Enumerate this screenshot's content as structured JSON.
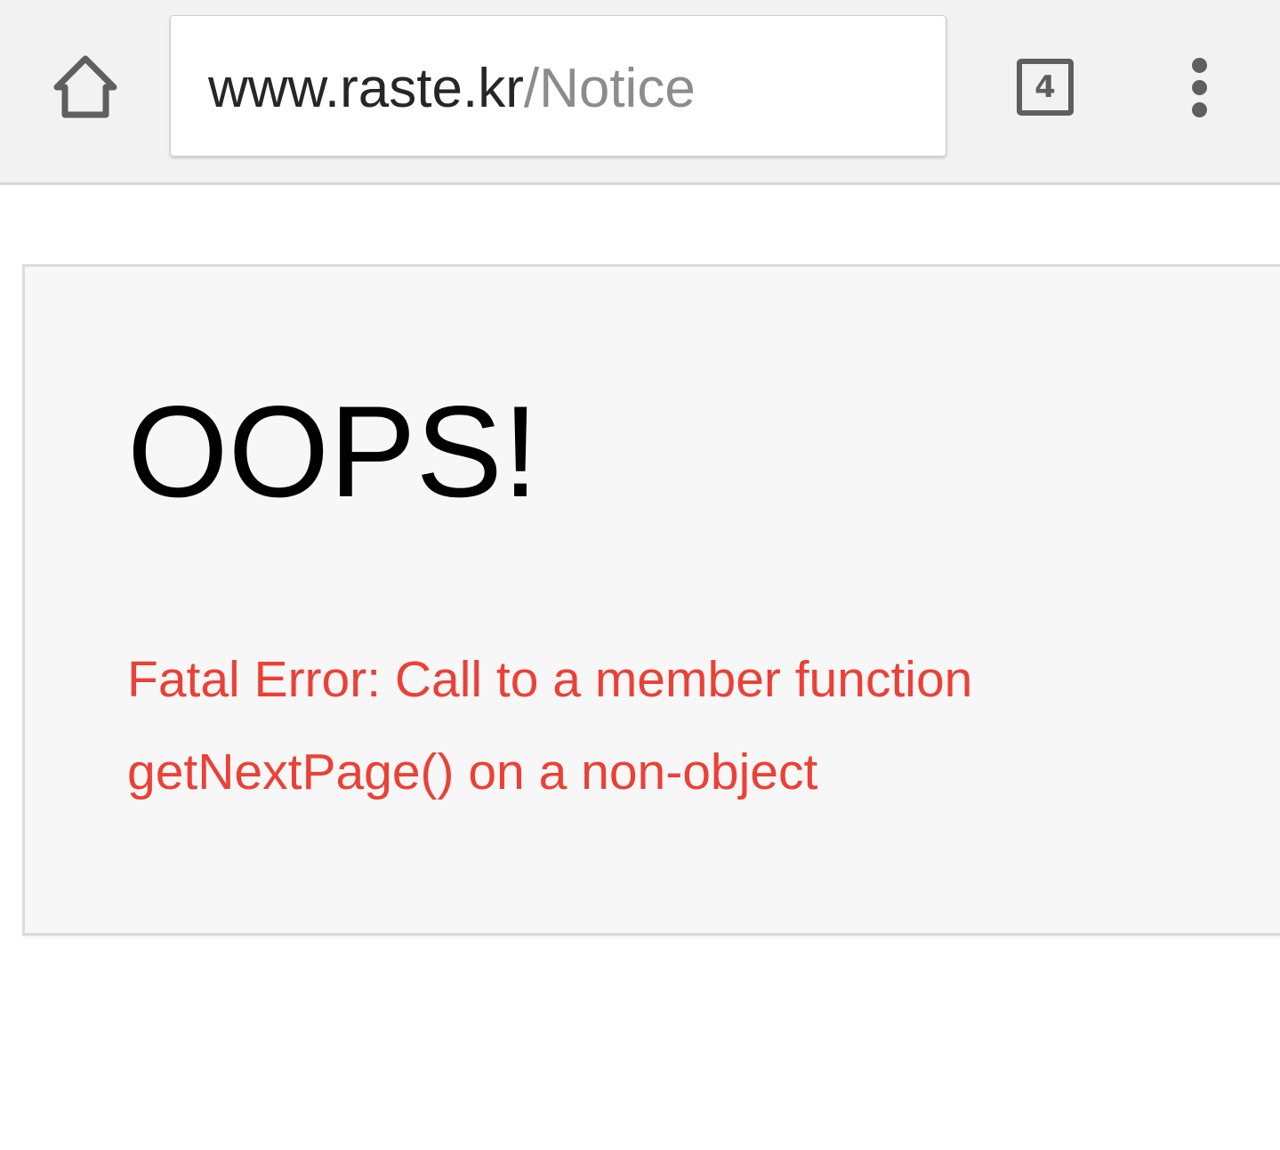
{
  "browser": {
    "url_host": "www.raste.kr",
    "url_path": "/Notice",
    "tab_count": "4",
    "icons": {
      "home": "home-icon",
      "tabs": "tabs-icon",
      "menu": "overflow-menu-icon"
    }
  },
  "page": {
    "title": "OOPS!",
    "error_message": "Fatal Error: Call to a member function getNextPage() on a non-object"
  },
  "colors": {
    "toolbar_bg": "#f2f2f2",
    "icon": "#5f5f5f",
    "error_text": "#ec4036",
    "card_bg": "#f7f7f7"
  }
}
